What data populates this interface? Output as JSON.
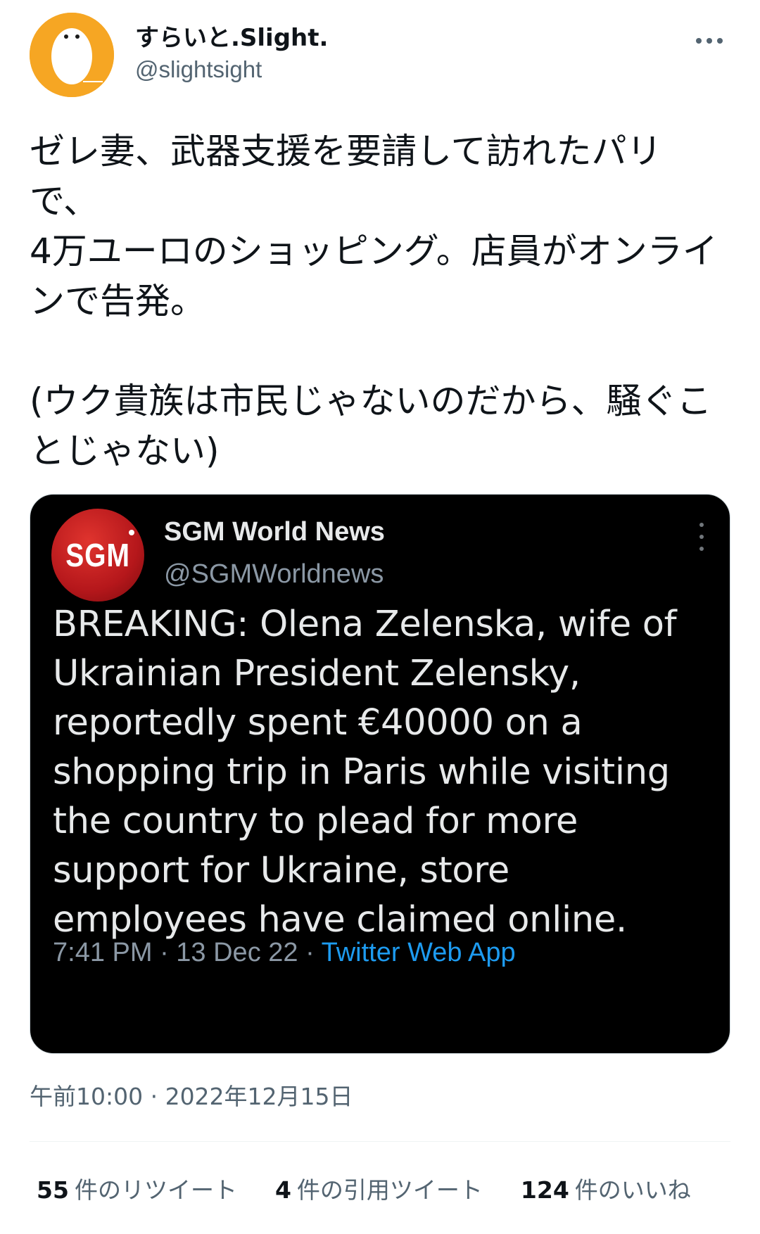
{
  "author": {
    "name": "すらいと.Slight.",
    "handle": "@slightsight"
  },
  "tweet": {
    "text": "ゼレ妻、武器支援を要請して訪れたパリで、\n4万ユーロのショッピング。店員がオンラインで告発。\n\n(ウク貴族は市民じゃないのだから、騒ぐことじゃない)",
    "timestamp": "午前10:00 · 2022年12月15日"
  },
  "embedded": {
    "logo_text": "SGM",
    "name": "SGM World News",
    "handle": "@SGMWorldnews",
    "text": "BREAKING: Olena Zelenska, wife of Ukrainian President Zelensky, reportedly spent €40000 on a shopping trip in Paris while visiting the country to plead for more support for Ukraine, store employees have claimed online.",
    "time": "7:41 PM · 13 Dec 22 · ",
    "source": "Twitter Web App"
  },
  "stats": {
    "retweets_count": "55",
    "retweets_label": "件のリツイート",
    "quotes_count": "4",
    "quotes_label": "件の引用ツイート",
    "likes_count": "124",
    "likes_label": "件のいいね"
  },
  "colors": {
    "avatar_bg": "#f6a623",
    "link": "#1d9bf0",
    "secondary_text": "#536471",
    "logo_red": "#c4161c"
  },
  "icons": {
    "avatar": "egg-avatar-icon",
    "more": "more-horizontal-icon",
    "embed_more": "more-vertical-icon"
  }
}
